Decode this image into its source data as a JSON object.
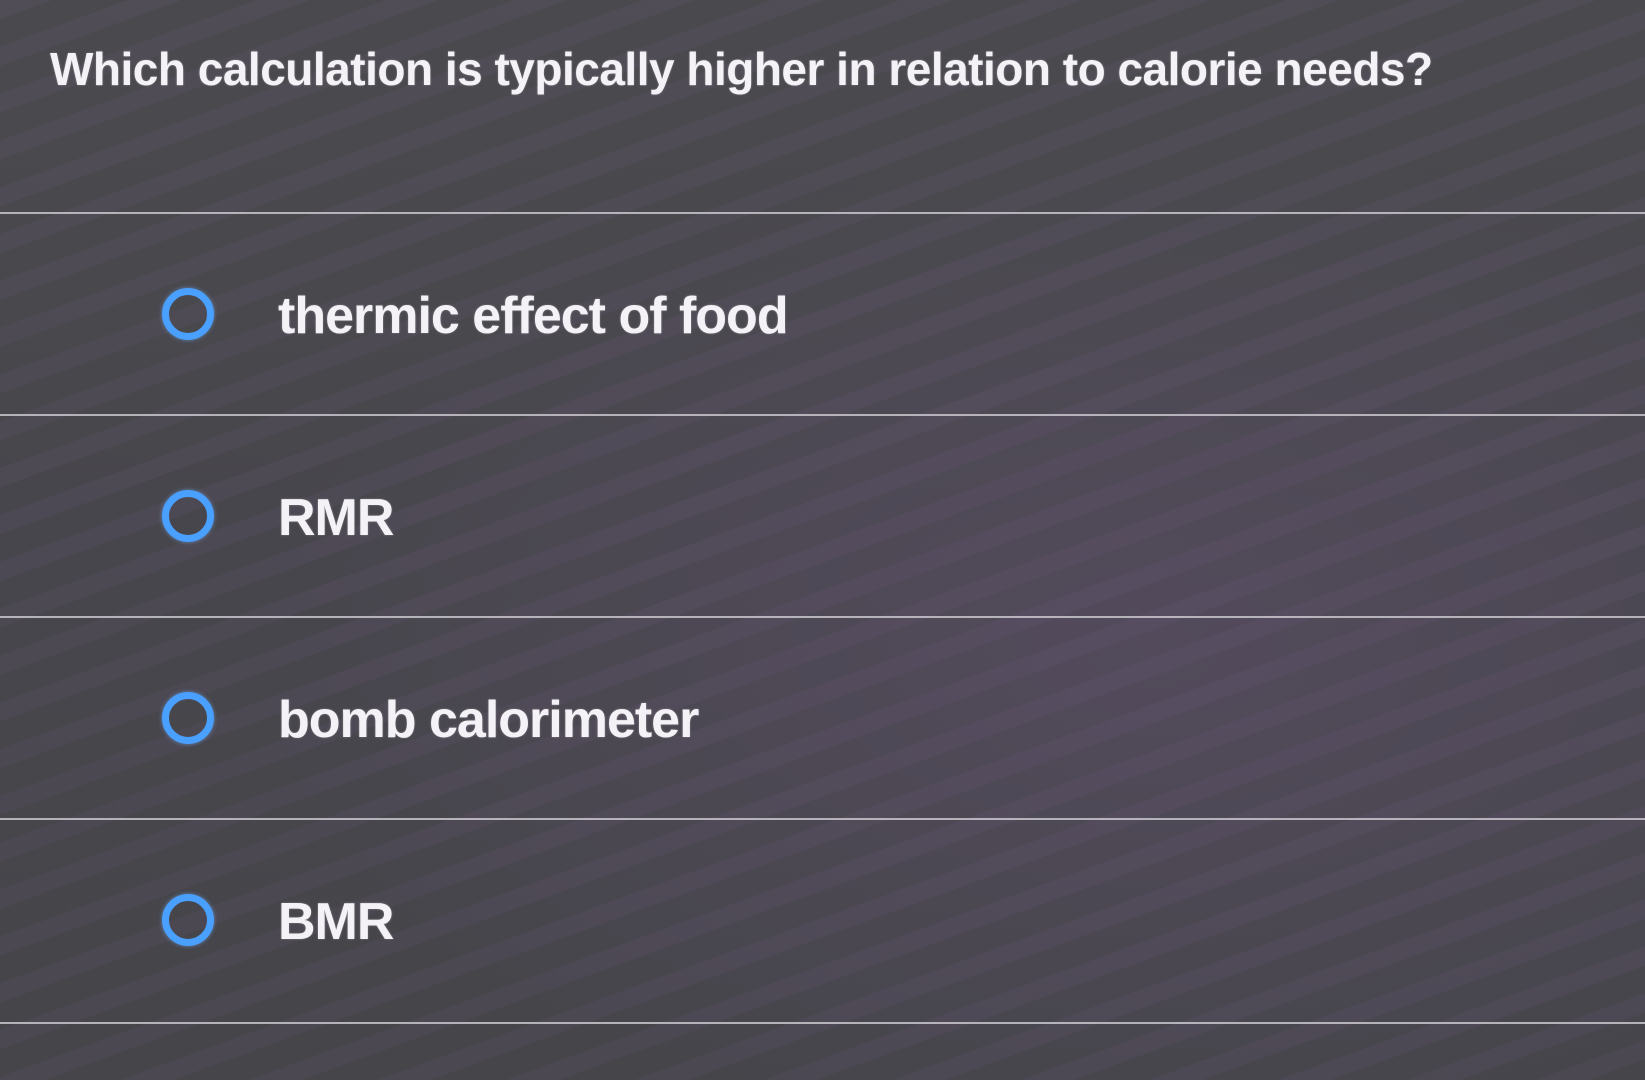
{
  "question": {
    "text": "Which calculation is typically higher in relation to calorie needs?"
  },
  "options": [
    {
      "label": "thermic effect of food",
      "selected": false
    },
    {
      "label": "RMR",
      "selected": false
    },
    {
      "label": "bomb calorimeter",
      "selected": false
    },
    {
      "label": "BMR",
      "selected": false
    }
  ],
  "colors": {
    "radio_border": "#4aa0ff",
    "text": "#f4f2f6",
    "background": "#47464c",
    "divider": "#c9c6cc"
  }
}
